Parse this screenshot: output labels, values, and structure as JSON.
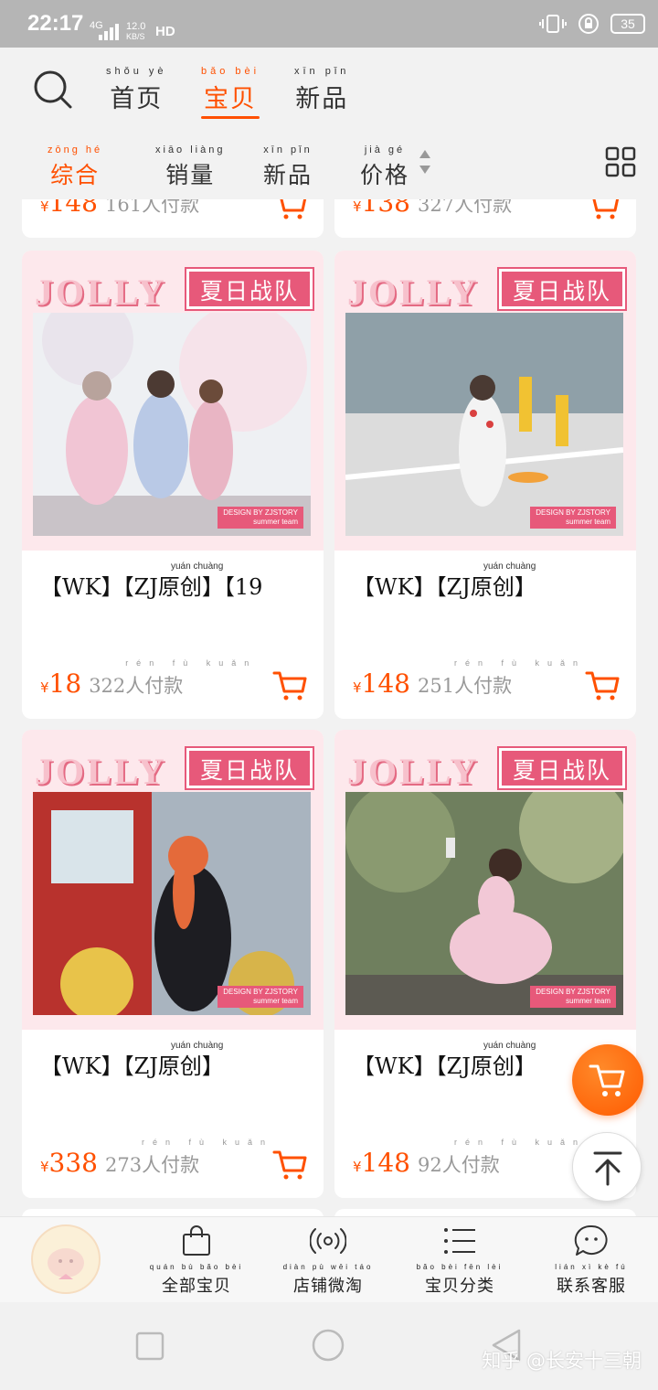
{
  "status_bar": {
    "time": "22:17",
    "network": "4G",
    "speed_value": "12.0",
    "speed_unit": "KB/S",
    "hd": "HD",
    "battery": "35"
  },
  "top_nav": {
    "tabs": [
      {
        "label": "首页",
        "pinyin": "shǒu yè"
      },
      {
        "label": "宝贝",
        "pinyin": "bǎo bèi"
      },
      {
        "label": "新品",
        "pinyin": "xīn pǐn"
      }
    ]
  },
  "sort_bar": {
    "options": [
      {
        "label": "综合",
        "pinyin": "zōng hé"
      },
      {
        "label": "销量",
        "pinyin": "xiāo liàng"
      },
      {
        "label": "新品",
        "pinyin": "xīn pǐn"
      },
      {
        "label": "价格",
        "pinyin": "jià gé"
      }
    ]
  },
  "partial_row": [
    {
      "yen": "¥",
      "price": "148",
      "paid": "161人付款"
    },
    {
      "yen": "¥",
      "price": "138",
      "paid": "327人付款"
    }
  ],
  "products": [
    {
      "title": "【WK】【ZJ原创】【19",
      "title_pinyin": "yuán chuàng",
      "yen": "¥",
      "price": "18",
      "paid": "322人付款",
      "paid_pinyin": "rén fù kuǎn"
    },
    {
      "title": "【WK】【ZJ原创】",
      "title_pinyin": "yuán chuàng",
      "yen": "¥",
      "price": "148",
      "paid": "251人付款",
      "paid_pinyin": "rén fù kuǎn"
    },
    {
      "title": "【WK】【ZJ原创】",
      "title_pinyin": "yuán chuàng",
      "yen": "¥",
      "price": "338",
      "paid": "273人付款",
      "paid_pinyin": "rén fù kuǎn"
    },
    {
      "title": "【WK】【ZJ原创】",
      "title_pinyin": "yuán chuàng",
      "yen": "¥",
      "price": "148",
      "paid": "92人付款",
      "paid_pinyin": "rén fù kuǎn"
    }
  ],
  "product_banner": {
    "brand": "JOLLY",
    "team": "夏日战队",
    "design_line1": "DESIGN BY ZJSTORY",
    "design_line2": "summer team"
  },
  "bottom_bar": {
    "items": [
      {
        "label": "全部宝贝",
        "pinyin": "quán bù bǎo bèi",
        "icon": "shopping-bag-icon"
      },
      {
        "label": "店铺微淘",
        "pinyin": "diàn pù wēi táo",
        "icon": "broadcast-icon"
      },
      {
        "label": "宝贝分类",
        "pinyin": "bǎo bèi fēn lèi",
        "icon": "list-icon"
      },
      {
        "label": "联系客服",
        "pinyin": "lián xì kè fú",
        "icon": "chat-icon"
      }
    ]
  },
  "watermark": "知乎 @长安十三朝",
  "colors": {
    "accent": "#ff5000",
    "banner_pink": "#e7597a",
    "background": "#f2f2f2"
  }
}
